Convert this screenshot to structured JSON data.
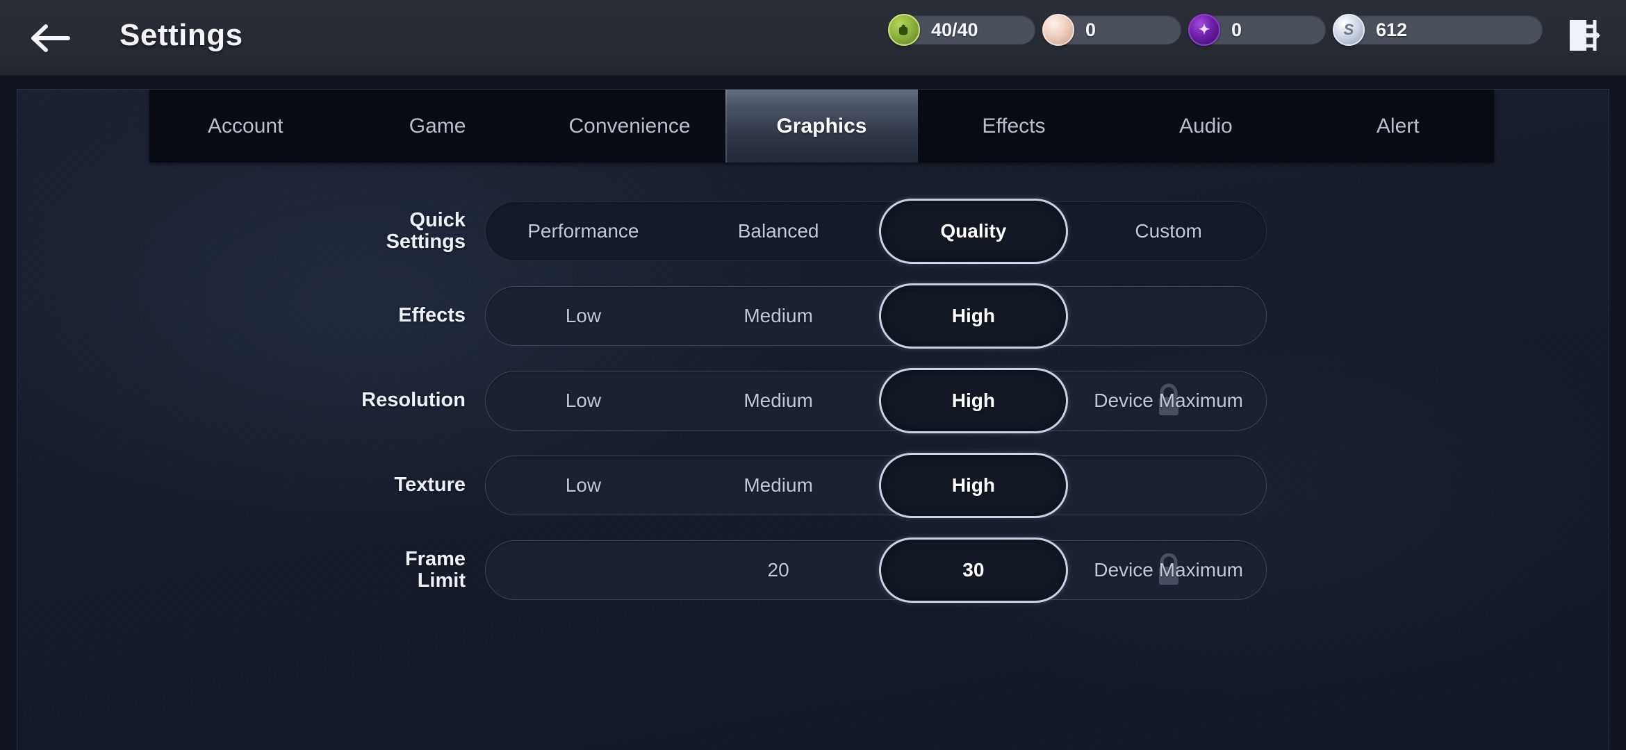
{
  "header": {
    "back_icon": "arrow-left-icon",
    "title": "Settings",
    "exit_icon": "exit-door-icon",
    "resources": [
      {
        "id": "stamina",
        "icon": "stamina-fist-icon",
        "value": "40/40",
        "color": "#8eb43c",
        "glyph": "✊"
      },
      {
        "id": "pearl",
        "icon": "pearl-icon",
        "value": "0",
        "color": "#f0cfc0",
        "glyph": ""
      },
      {
        "id": "gem",
        "icon": "gem-icon",
        "value": "0",
        "color": "#6d1fa8",
        "glyph": "✦"
      },
      {
        "id": "silver",
        "icon": "silver-coin-icon",
        "value": "612",
        "color": "#cfd8e6",
        "glyph": "S"
      }
    ]
  },
  "tabs": [
    {
      "label": "Account",
      "active": false
    },
    {
      "label": "Game",
      "active": false
    },
    {
      "label": "Convenience",
      "active": false
    },
    {
      "label": "Graphics",
      "active": true
    },
    {
      "label": "Effects",
      "active": false
    },
    {
      "label": "Audio",
      "active": false
    },
    {
      "label": "Alert",
      "active": false
    }
  ],
  "settings_rows": [
    {
      "label": "Quick\nSettings",
      "style": "dark",
      "options": [
        {
          "text": "Performance",
          "selected": false,
          "locked": false
        },
        {
          "text": "Balanced",
          "selected": false,
          "locked": false
        },
        {
          "text": "Quality",
          "selected": true,
          "locked": false
        },
        {
          "text": "Custom",
          "selected": false,
          "locked": false
        }
      ]
    },
    {
      "label": "Effects",
      "style": "light",
      "options": [
        {
          "text": "Low",
          "selected": false,
          "locked": false
        },
        {
          "text": "Medium",
          "selected": false,
          "locked": false
        },
        {
          "text": "High",
          "selected": true,
          "locked": false
        },
        {
          "text": "",
          "selected": false,
          "locked": false,
          "empty": true
        }
      ]
    },
    {
      "label": "Resolution",
      "style": "light",
      "options": [
        {
          "text": "Low",
          "selected": false,
          "locked": false
        },
        {
          "text": "Medium",
          "selected": false,
          "locked": false
        },
        {
          "text": "High",
          "selected": true,
          "locked": false
        },
        {
          "text": "Device Maximum",
          "selected": false,
          "locked": true
        }
      ]
    },
    {
      "label": "Texture",
      "style": "light",
      "options": [
        {
          "text": "Low",
          "selected": false,
          "locked": false
        },
        {
          "text": "Medium",
          "selected": false,
          "locked": false
        },
        {
          "text": "High",
          "selected": true,
          "locked": false
        },
        {
          "text": "",
          "selected": false,
          "locked": false,
          "empty": true
        }
      ]
    },
    {
      "label": "Frame\nLimit",
      "style": "light",
      "options": [
        {
          "text": "",
          "selected": false,
          "locked": false,
          "empty": true
        },
        {
          "text": "20",
          "selected": false,
          "locked": false
        },
        {
          "text": "30",
          "selected": true,
          "locked": false
        },
        {
          "text": "Device Maximum",
          "selected": false,
          "locked": true
        }
      ]
    }
  ],
  "colors": {
    "panel_bg": "#161c2a",
    "topbar_bg": "#272b34",
    "tabbar_bg": "#090c15",
    "accent_border": "#c9d2e2",
    "text_primary": "#eef1f7",
    "text_muted": "#c2c9d6"
  }
}
